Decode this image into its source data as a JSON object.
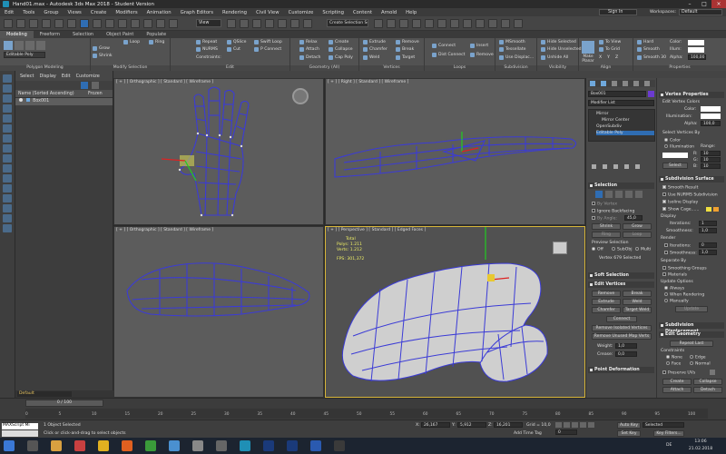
{
  "titlebar": {
    "title": "Hand01.max - Autodesk 3ds Max 2018 - Student Version"
  },
  "menu": [
    "Edit",
    "Tools",
    "Group",
    "Views",
    "Create",
    "Modifiers",
    "Animation",
    "Graph Editors",
    "Rendering",
    "Civil View",
    "Customize",
    "Scripting",
    "Content",
    "Arnold",
    "Help"
  ],
  "menu_right": {
    "sign_in": "Sign In",
    "workspaces_label": "Workspaces:",
    "workspace": "Default"
  },
  "toolbar": {
    "view_dropdown": "View",
    "selection_set": "Create Selection Se"
  },
  "ribbon_tabs": [
    "Modeling",
    "Freeform",
    "Selection",
    "Object Paint",
    "Populate"
  ],
  "ribbon": {
    "polygon_modeling": {
      "title": "Polygon Modeling",
      "object": "Editable Poly"
    },
    "modify_selection": {
      "title": "Modify Selection",
      "loop": "Loop",
      "ring": "Ring",
      "grow": "Grow",
      "shrink": "Shrink"
    },
    "edit": {
      "title": "Edit",
      "repeat": "Repeat",
      "qslice": "QSlice",
      "swift_loop": "Swift Loop",
      "nurms": "NURMS",
      "cut": "Cut",
      "p_connect": "P Connect",
      "constraints": "Constraints:"
    },
    "geometry": {
      "title": "Geometry (All)",
      "relax": "Relax",
      "create": "Create",
      "attach": "Attach",
      "collapse": "Collapse",
      "detach": "Detach",
      "cap_poly": "Cap Poly"
    },
    "vertices": {
      "title": "Vertices",
      "extrude": "Extrude",
      "remove": "Remove",
      "chamfer": "Chamfer",
      "break": "Break",
      "weld": "Weld",
      "target": "Target"
    },
    "loops": {
      "title": "Loops",
      "connect": "Connect",
      "insert": "Insert",
      "dist_connect": "Dist Connect",
      "remove": "Remove"
    },
    "subdivision": {
      "title": "Subdivision",
      "msmooth": "MSmooth",
      "tessellate": "Tessellate",
      "use_displace": "Use Displac..."
    },
    "visibility": {
      "title": "Visibility",
      "hide_selected": "Hide Selected",
      "hide_unselected": "Hide Unselected",
      "unhide_all": "Unhide All"
    },
    "align": {
      "title": "Align",
      "make_planar": "Make Planar",
      "to_view": "To View",
      "to_grid": "To Grid",
      "x": "X",
      "y": "Y",
      "z": "Z"
    },
    "properties": {
      "title": "Properties",
      "hard": "Hard",
      "smooth": "Smooth",
      "smooth30": "Smooth 30",
      "color": "Color:",
      "illum": "Illum:",
      "alpha": "Alpha:",
      "alpha_value": "100,00"
    }
  },
  "scene_explorer": {
    "menu": [
      "Select",
      "Display",
      "Edit",
      "Customize"
    ],
    "header_name": "Name (Sorted Ascending)",
    "header_frozen": "Frozen",
    "items": [
      {
        "name": "Box001"
      }
    ]
  },
  "viewports": {
    "top_left": "[ + ] [ Orthographic ] [ Standard ] [ Wireframe ]",
    "top_right": "[ + ] [ Right ] [ Standard ] [ Wireframe ]",
    "bottom_left": "[ + ] [ Orthographic ] [ Standard ] [ Wireframe ]",
    "bottom_right": "[ + ] [ Perspective ] [ Standard ] [ Edged Faces ]",
    "stats": {
      "total": "Total",
      "polys_label": "Polys:",
      "polys": "1.211",
      "verts_label": "Verts:",
      "verts": "1.212",
      "fps_label": "FPS:",
      "fps": "301,372"
    }
  },
  "command_panel": {
    "object_name": "Box001",
    "modifier_list": "Modifier List",
    "stack": [
      "Mirror",
      "Mirror Center",
      "OpenSubdiv",
      "Editable Poly"
    ],
    "selection": {
      "title": "Selection",
      "by_vertex": "By Vertex",
      "ignore_backfacing": "Ignore Backfacing",
      "by_angle": "By Angle:",
      "by_angle_value": "45,0",
      "shrink": "Shrink",
      "grow": "Grow",
      "ring": "Ring",
      "loop": "Loop",
      "preview_selection": "Preview Selection",
      "off": "Off",
      "subobj": "SubObj",
      "multi": "Multi",
      "status": "Vertex 679 Selected"
    },
    "soft_selection": "Soft Selection",
    "edit_vertices": {
      "title": "Edit Vertices",
      "remove": "Remove",
      "break": "Break",
      "extrude": "Extrude",
      "weld": "Weld",
      "chamfer": "Chamfer",
      "target_weld": "Target Weld",
      "connect": "Connect",
      "remove_isolated": "Remove Isolated Vertices",
      "remove_unused": "Remove Unused Map Verts",
      "weight_label": "Weight:",
      "weight": "1,0",
      "crease_label": "Crease:",
      "crease": "0,0"
    },
    "point_deformation": "Point Deformation"
  },
  "command_panel2": {
    "vertex_properties": {
      "title": "Vertex Properties",
      "edit_colors": "Edit Vertex Colors",
      "color": "Color:",
      "illumination": "Illumination:",
      "alpha": "Alpha:",
      "alpha_value": "100,0",
      "select_by": "Select Vertices By",
      "color_opt": "Color",
      "illum_opt": "Illumination",
      "range": "Range:",
      "r": "R:",
      "g": "G:",
      "b": "B:",
      "range_value": "10",
      "select": "Select"
    },
    "subdivision_surface": {
      "title": "Subdivision Surface",
      "smooth_result": "Smooth Result",
      "use_nurms": "Use NURMS Subdivision",
      "isoline": "Isoline Display",
      "show_cage": "Show Cage......",
      "display": "Display",
      "iterations": "Iterations:",
      "iterations_value": "1",
      "smoothness": "Smoothness:",
      "smoothness_value": "1,0",
      "render": "Render",
      "r_iterations_value": "0",
      "r_smoothness_value": "1,0",
      "separate_by": "Separate By",
      "smoothing_groups": "Smoothing Groups",
      "materials": "Materials",
      "update_options": "Update Options",
      "always": "Always",
      "when_rendering": "When Rendering",
      "manually": "Manually",
      "update": "Update"
    },
    "subdivision_displacement": "Subdivision Displacement",
    "edit_geometry": {
      "title": "Edit Geometry",
      "repeat_last": "Repeat Last",
      "constraints": "Constraints",
      "none": "None",
      "edge": "Edge",
      "face": "Face",
      "normal": "Normal",
      "preserve_uvs": "Preserve UVs",
      "create": "Create",
      "collapse": "Collapse",
      "attach": "Attach",
      "detach": "Detach"
    }
  },
  "timeline": {
    "frame": "0 / 100",
    "ticks": [
      "0",
      "5",
      "10",
      "15",
      "20",
      "25",
      "30",
      "35",
      "40",
      "45",
      "50",
      "55",
      "60",
      "65",
      "70",
      "75",
      "80",
      "85",
      "90",
      "95",
      "100"
    ]
  },
  "status": {
    "script_field": "MAXScript Mi",
    "line1": "1 Object Selected",
    "line2": "Click or click-and-drag to select objects",
    "x_label": "X:",
    "x": "26,167",
    "y_label": "Y:",
    "y": "5,912",
    "z_label": "Z:",
    "z": "16,201",
    "grid": "Grid = 10,0",
    "add_time_tag": "Add Time Tag",
    "auto_key": "Auto Key",
    "set_key": "Set Key",
    "selected": "Selected",
    "key_filters": "Key Filters...",
    "frame_value": "0",
    "layer": "Default"
  },
  "taskbar": {
    "lang": "DE",
    "time": "13:06",
    "date": "21.02.2018"
  },
  "colors": {
    "accent": "#2f6db3",
    "active_viewport": "#d8b63a",
    "wire": "#3b3bd6"
  }
}
